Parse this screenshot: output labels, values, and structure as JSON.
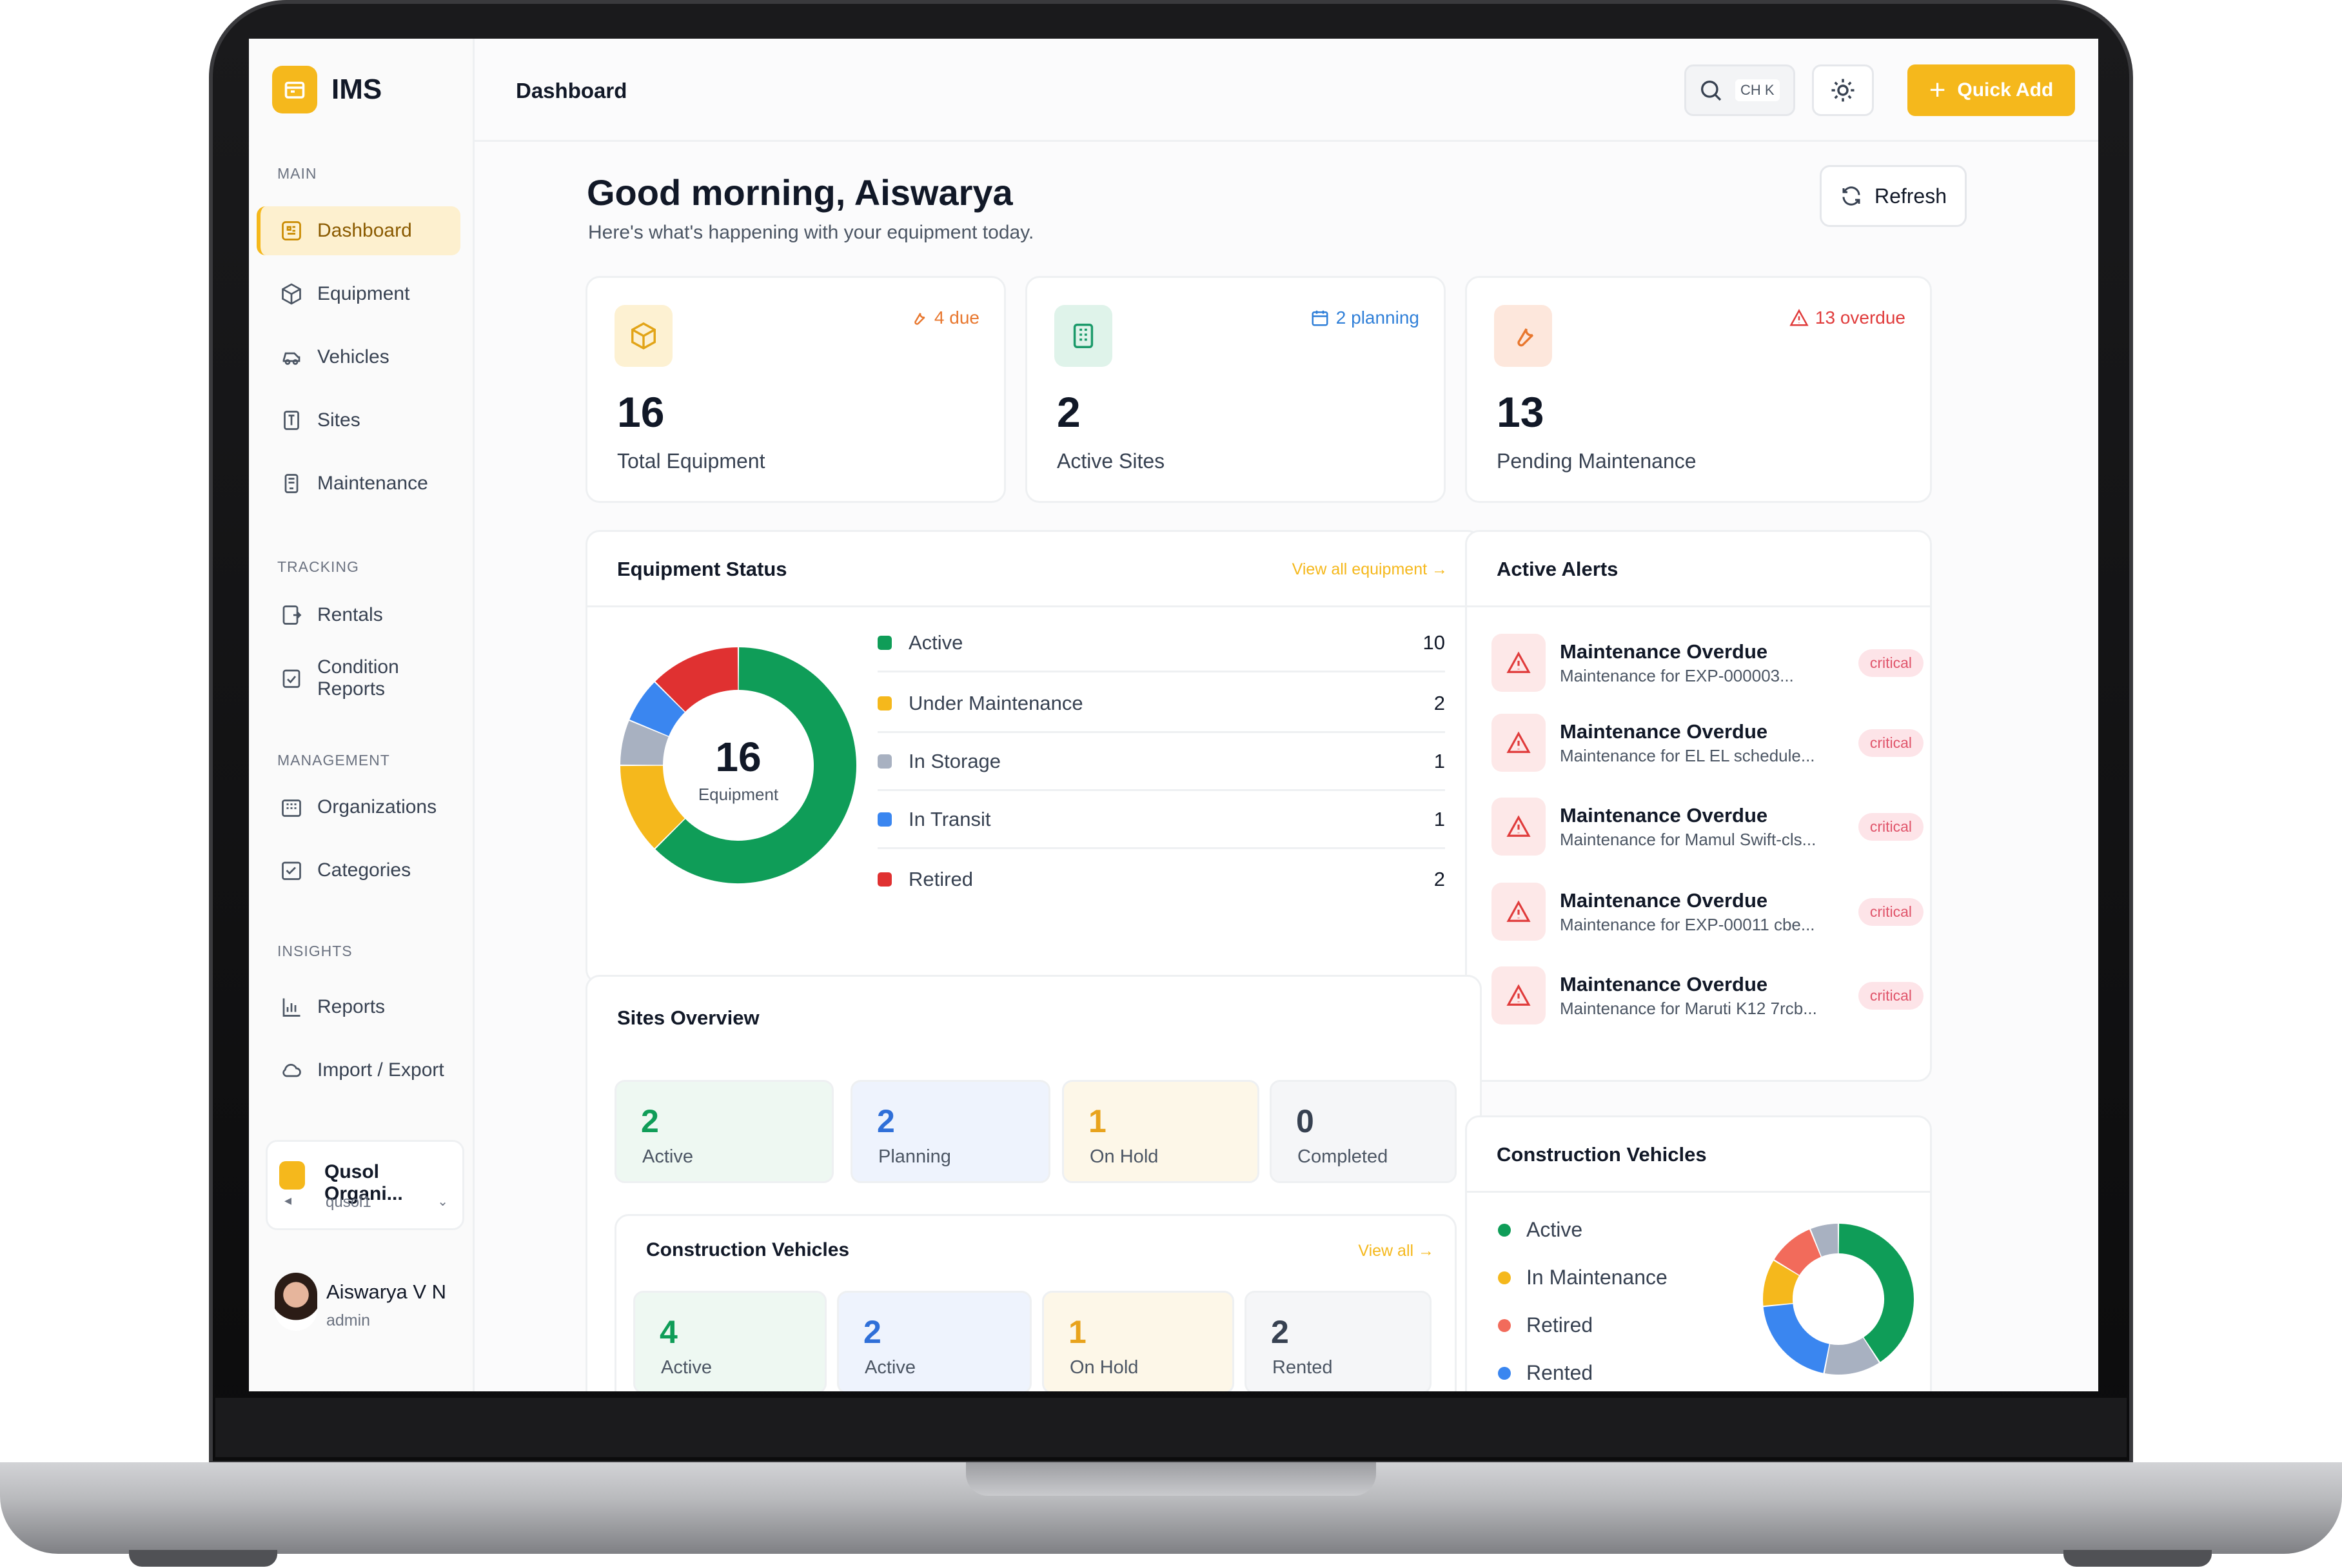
{
  "app": {
    "name": "IMS"
  },
  "sidebar": {
    "sections": [
      {
        "heading": "MAIN"
      },
      {
        "heading": "TRACKING"
      },
      {
        "heading": "MANAGEMENT"
      },
      {
        "heading": "INSIGHTS"
      }
    ],
    "items": [
      {
        "label": "Dashboard",
        "icon": "dashboard-icon",
        "active": true
      },
      {
        "label": "Equipment",
        "icon": "box-icon"
      },
      {
        "label": "Vehicles",
        "icon": "vehicle-icon"
      },
      {
        "label": "Sites",
        "icon": "building-icon"
      },
      {
        "label": "Maintenance",
        "icon": "maintenance-icon"
      },
      {
        "label": "Rentals",
        "icon": "rentals-icon"
      },
      {
        "label": "Condition Reports",
        "icon": "clipboard-icon"
      },
      {
        "label": "Organizations",
        "icon": "organizations-icon"
      },
      {
        "label": "Categories",
        "icon": "categories-icon"
      },
      {
        "label": "Reports",
        "icon": "reports-icon"
      },
      {
        "label": "Import / Export",
        "icon": "cloud-icon"
      }
    ],
    "org": {
      "name": "Qusol Organi...",
      "slug": "qusol1"
    },
    "user": {
      "name": "Aiswarya V N",
      "role": "admin"
    }
  },
  "topbar": {
    "title": "Dashboard",
    "search_shortcut": "CH K",
    "quick_add_label": "Quick Add"
  },
  "main": {
    "greeting": "Good morning, Aiswarya",
    "subtitle": "Here's what's happening with your equipment today.",
    "refresh_label": "Refresh",
    "stats": [
      {
        "value": "16",
        "label": "Total Equipment",
        "badge": "4 due",
        "badge_color": "#e8772e",
        "icon": "box-icon"
      },
      {
        "value": "2",
        "label": "Active Sites",
        "badge": "2 planning",
        "badge_color": "#2f7fd8",
        "icon": "building-icon"
      },
      {
        "value": "13",
        "label": "Pending Maintenance",
        "badge": "13 overdue",
        "badge_color": "#e03b3b",
        "icon": "wrench-icon"
      }
    ],
    "equipment_status": {
      "title": "Equipment Status",
      "link": "View all equipment →",
      "total": "16",
      "total_label": "Equipment",
      "items": [
        {
          "name": "Active",
          "value": 10,
          "color": "#0f9d58"
        },
        {
          "name": "Under Maintenance",
          "value": 2,
          "color": "#f5b81c"
        },
        {
          "name": "In Storage",
          "value": 1,
          "color": "#a8b1c1"
        },
        {
          "name": "In Transit",
          "value": 1,
          "color": "#3a86f0"
        },
        {
          "name": "Retired",
          "value": 2,
          "color": "#e03131"
        }
      ]
    },
    "alerts": {
      "title": "Active Alerts",
      "items": [
        {
          "title": "Maintenance Overdue",
          "desc": "Maintenance for EXP-000003...",
          "severity": "critical"
        },
        {
          "title": "Maintenance Overdue",
          "desc": "Maintenance for EL EL schedule...",
          "severity": "critical"
        },
        {
          "title": "Maintenance Overdue",
          "desc": "Maintenance for Mamul Swift-cls...",
          "severity": "critical"
        },
        {
          "title": "Maintenance Overdue",
          "desc": "Maintenance for EXP-00011 cbe...",
          "severity": "critical"
        },
        {
          "title": "Maintenance Overdue",
          "desc": "Maintenance for Maruti K12 7rcb...",
          "severity": "critical"
        }
      ]
    },
    "sites_overview": {
      "title": "Sites Overview",
      "tiles": [
        {
          "value": "2",
          "label": "Active",
          "color": "#0f9d58",
          "bg": "#eef8f2"
        },
        {
          "value": "2",
          "label": "Planning",
          "color": "#2f6fd8",
          "bg": "#eef3fd"
        },
        {
          "value": "1",
          "label": "On Hold",
          "color": "#e8a31c",
          "bg": "#fdf7e8"
        },
        {
          "value": "0",
          "label": "Completed",
          "color": "#374151",
          "bg": "#f5f6f8"
        }
      ]
    },
    "construction_inner": {
      "title": "Construction Vehicles",
      "link": "View all →",
      "tiles": [
        {
          "value": "4",
          "label": "Active",
          "color": "#0f9d58",
          "bg": "#eef8f2"
        },
        {
          "value": "2",
          "label": "Active",
          "color": "#2f6fd8",
          "bg": "#eef3fd"
        },
        {
          "value": "1",
          "label": "On Hold",
          "color": "#e8a31c",
          "bg": "#fdf7e8"
        },
        {
          "value": "2",
          "label": "Rented",
          "color": "#374151",
          "bg": "#f5f6f8"
        }
      ]
    },
    "construction_vehicles": {
      "title": "Construction Vehicles",
      "legend": [
        {
          "name": "Active",
          "color": "#0f9d58",
          "value": 4
        },
        {
          "name": "In Maintenance",
          "color": "#f5b81c",
          "value": 1
        },
        {
          "name": "Retired",
          "color": "#f26b5b",
          "value": 1
        },
        {
          "name": "Rented",
          "color": "#3a86f0",
          "value": 2
        }
      ]
    }
  }
}
